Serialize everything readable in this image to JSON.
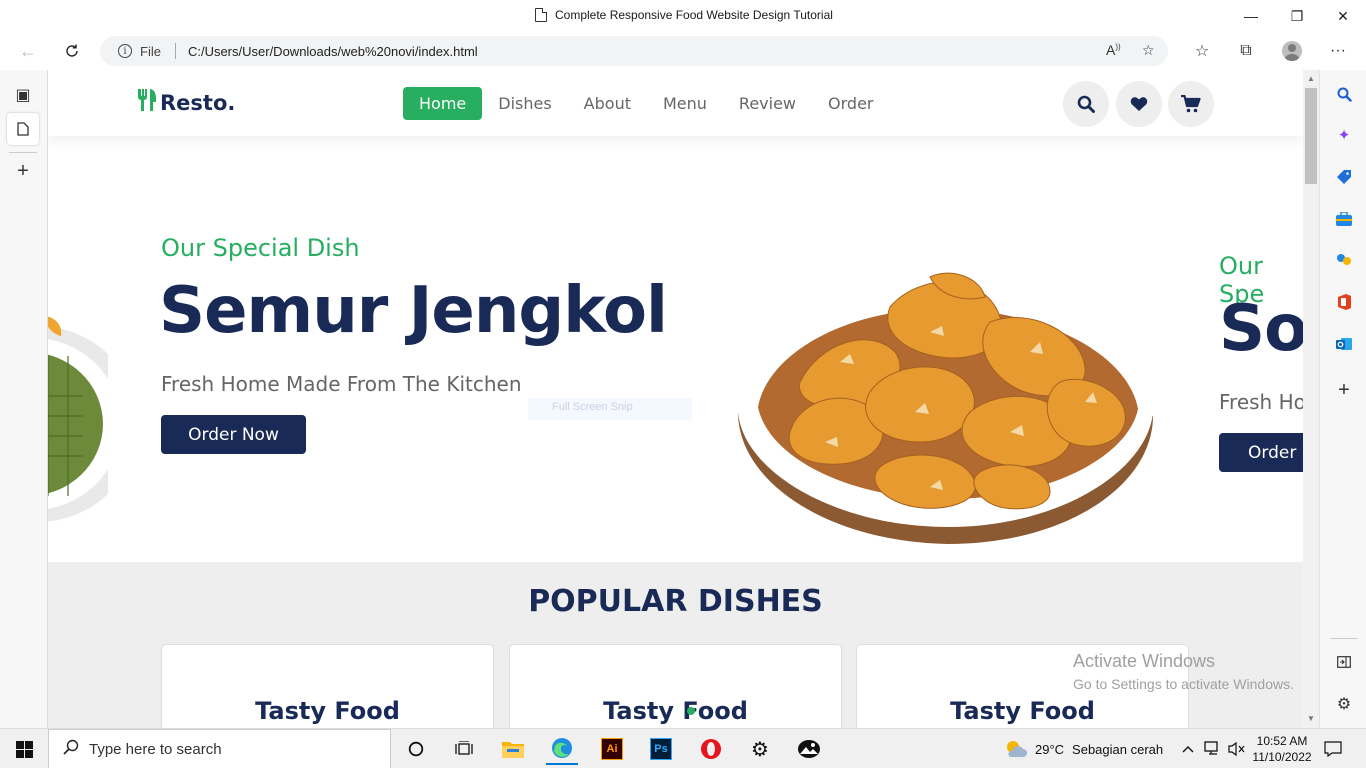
{
  "window": {
    "title": "Complete Responsive Food Website Design Tutorial",
    "minimize": "—",
    "maximize": "❐",
    "close": "✕"
  },
  "address_bar": {
    "file_label": "File",
    "url": "C:/Users/User/Downloads/web%20novi/index.html"
  },
  "site": {
    "logo_text": "Resto.",
    "nav": [
      "Home",
      "Dishes",
      "About",
      "Menu",
      "Review",
      "Order"
    ],
    "active_nav": "Home"
  },
  "hero": {
    "slide1": {
      "subtitle": "Our Special Dish",
      "title": "Semur Jengkol",
      "lead": "Fresh Home Made From The Kitchen",
      "button": "Order Now"
    },
    "slide2": {
      "subtitle": "Our Spe",
      "title": "So",
      "lead": "Fresh Ho",
      "button": "Order N"
    },
    "overlay_text": "Full Screen Snip"
  },
  "popular": {
    "heading": "POPULAR DISHES",
    "cards": [
      "Tasty Food",
      "Tasty Food",
      "Tasty Food"
    ]
  },
  "watermark": {
    "line1": "Activate Windows",
    "line2": "Go to Settings to activate Windows."
  },
  "taskbar": {
    "search_placeholder": "Type here to search",
    "weather_temp": "29°C",
    "weather_desc": "Sebagian cerah",
    "time": "10:52 AM",
    "date": "11/10/2022"
  },
  "colors": {
    "brand_green": "#27ae60",
    "navy": "#192a56",
    "light_bg": "#eeeeee"
  }
}
